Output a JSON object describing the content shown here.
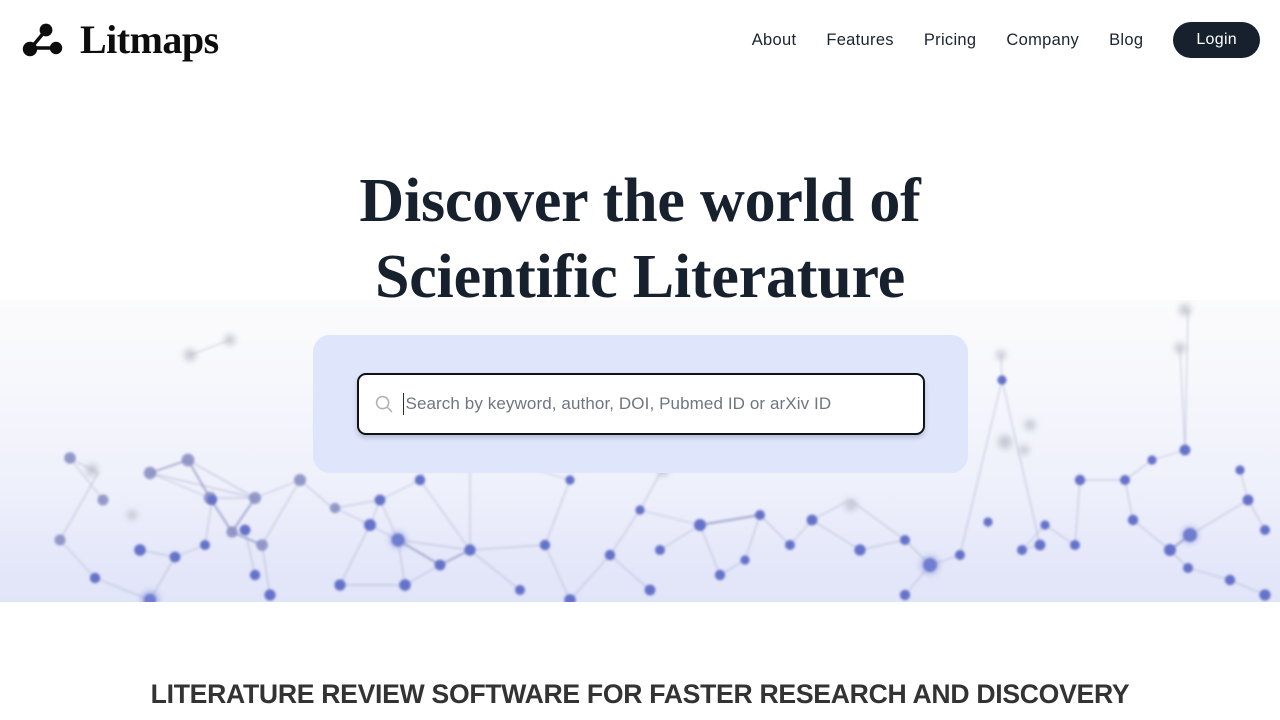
{
  "header": {
    "brand_name": "Litmaps",
    "brand_icon": "litmaps-node-logo",
    "nav": [
      {
        "label": "About",
        "name": "nav-link-about"
      },
      {
        "label": "Features",
        "name": "nav-link-features"
      },
      {
        "label": "Pricing",
        "name": "nav-link-pricing"
      },
      {
        "label": "Company",
        "name": "nav-link-company"
      },
      {
        "label": "Blog",
        "name": "nav-link-blog"
      }
    ],
    "login_label": "Login"
  },
  "hero": {
    "heading_line1": "Discover the world of",
    "heading_line2": "Scientific Literature"
  },
  "search": {
    "icon": "search-icon",
    "placeholder": "Search by keyword, author, DOI, Pubmed ID or arXiv ID",
    "value": ""
  },
  "tagline": {
    "text": "LITERATURE REVIEW SOFTWARE FOR FASTER RESEARCH AND DISCOVERY"
  },
  "colors": {
    "brand_dark": "#17212e",
    "search_panel": "#dfe5fb",
    "node_blue": "#6572c9",
    "node_gray": "#b9bcc7",
    "page_background": "#ffffff",
    "tagline_gray": "#333333"
  }
}
